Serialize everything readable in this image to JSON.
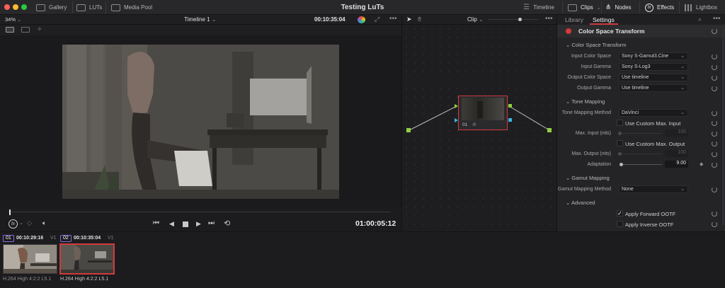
{
  "window": {
    "title": "Testing LuTs"
  },
  "topbar": {
    "left": [
      {
        "label": "Gallery",
        "icon": "gallery-icon"
      },
      {
        "label": "LUTs",
        "icon": "luts-icon"
      },
      {
        "label": "Media Pool",
        "icon": "media-pool-icon"
      }
    ],
    "right": [
      {
        "label": "Timeline",
        "icon": "timeline-icon"
      },
      {
        "label": "Clips",
        "icon": "clips-icon"
      },
      {
        "label": "Nodes",
        "icon": "nodes-icon"
      },
      {
        "label": "Effects",
        "icon": "fx-icon"
      },
      {
        "label": "Lightbox",
        "icon": "lightbox-icon"
      }
    ]
  },
  "viewer": {
    "zoom": "34%",
    "timeline_name": "Timeline 1",
    "source_timecode": "00:10:35:04",
    "record_timecode": "01:00:05:12"
  },
  "nodes": {
    "mode": "Clip",
    "node_label": "01"
  },
  "panel": {
    "tabs": [
      "Library",
      "Settings"
    ],
    "active_tab": "Settings",
    "effect_title": "Color Space Transform",
    "sections": {
      "cst": "Color Space Transform",
      "tone": "Tone Mapping",
      "gamut": "Gamut Mapping",
      "advanced": "Advanced"
    },
    "rows": {
      "input_color_space": {
        "label": "Input Color Space",
        "value": "Sony S-Gamut3.Cine"
      },
      "input_gamma": {
        "label": "Input Gamma",
        "value": "Sony S-Log3"
      },
      "output_color_space": {
        "label": "Output Color Space",
        "value": "Use timeline"
      },
      "output_gamma": {
        "label": "Output Gamma",
        "value": "Use timeline"
      },
      "tone_mapping_method": {
        "label": "Tone Mapping Method",
        "value": "DaVinci"
      },
      "use_custom_max_input": {
        "label": "Use Custom Max. Input",
        "checked": false
      },
      "max_input": {
        "label": "Max. Input (nits)",
        "value": "100"
      },
      "use_custom_max_output": {
        "label": "Use Custom Max. Output",
        "checked": false
      },
      "max_output": {
        "label": "Max. Output (nits)",
        "value": "100"
      },
      "adaptation": {
        "label": "Adaptation",
        "value": "9.00"
      },
      "gamut_mapping_method": {
        "label": "Gamut Mapping Method",
        "value": "None"
      },
      "apply_forward_ootf": {
        "label": "Apply Forward OOTF",
        "checked": true
      },
      "apply_inverse_ootf": {
        "label": "Apply Inverse OOTF",
        "checked": false
      }
    }
  },
  "timeline": {
    "clips": [
      {
        "num": "01",
        "timecode": "00:10:29:16",
        "track": "V1",
        "codec": "H.264 High 4:2:2 L5.1",
        "num_color": "#8a6be0",
        "selected": false
      },
      {
        "num": "02",
        "timecode": "00:10:35:04",
        "track": "V1",
        "codec": "H.264 High 4:2:2 L5.1",
        "num_color": "#8a6be0",
        "selected": true
      }
    ]
  },
  "colors": {
    "accent_red": "#d23a3a",
    "node_green": "#8fd13f",
    "node_blue": "#3db5e6"
  }
}
